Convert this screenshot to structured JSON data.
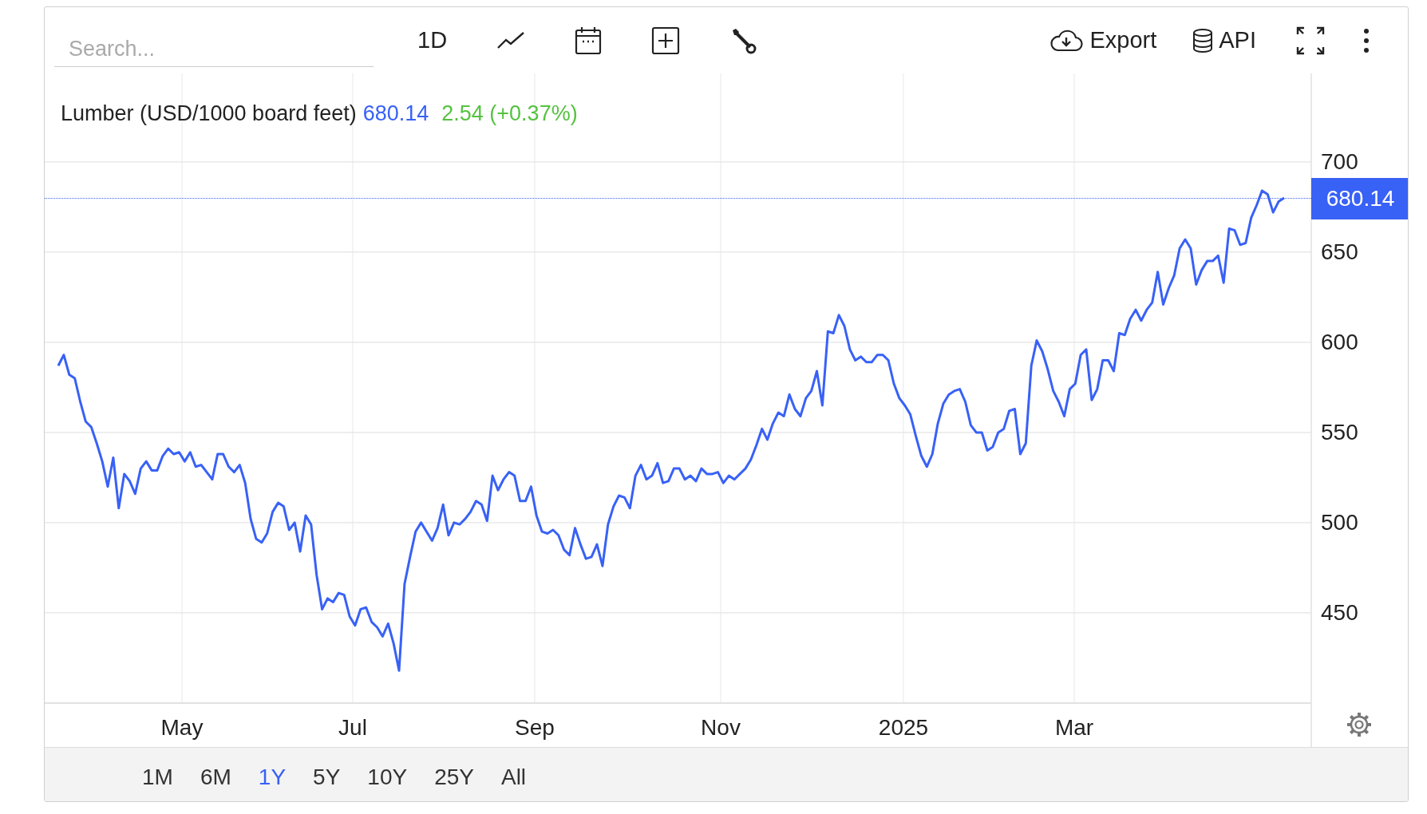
{
  "toolbar": {
    "search": {
      "placeholder": "Search..."
    },
    "interval": "1D",
    "export_label": "Export",
    "api_label": "API"
  },
  "chart": {
    "title": "Lumber (USD/1000 board feet)",
    "last_price": "680.14",
    "change": "2.54 (+0.37%)",
    "price_badge": "680.14",
    "x_labels": [
      "May",
      "Jul",
      "Sep",
      "Nov",
      "2025",
      "Mar"
    ],
    "chart_data": {
      "type": "line",
      "ylim": [
        400,
        749
      ],
      "grid": true,
      "yticks": [
        450,
        500,
        550,
        600,
        650,
        700
      ],
      "series": [
        {
          "color": "#3861f6",
          "values": [
            587,
            593,
            582,
            580,
            567,
            556,
            553,
            544,
            534,
            520,
            536,
            508,
            527,
            523,
            516,
            530,
            534,
            529,
            529,
            537,
            541,
            538,
            539,
            534,
            539,
            531,
            532,
            528,
            524,
            538,
            538,
            531,
            528,
            532,
            522,
            502,
            491,
            489,
            494,
            506,
            511,
            509,
            496,
            500,
            484,
            504,
            499,
            471,
            452,
            458,
            456,
            461,
            460,
            448,
            443,
            452,
            453,
            445,
            442,
            437,
            444,
            433,
            418,
            466,
            481,
            495,
            500,
            495,
            490,
            497,
            510,
            493,
            500,
            499,
            502,
            506,
            512,
            510,
            501,
            526,
            518,
            524,
            528,
            526,
            512,
            512,
            520,
            504,
            495,
            494,
            496,
            493,
            485,
            482,
            497,
            488,
            480,
            481,
            488,
            476,
            499,
            509,
            515,
            514,
            508,
            526,
            532,
            524,
            526,
            533,
            522,
            523,
            530,
            530,
            524,
            526,
            523,
            530,
            527,
            527,
            528,
            522,
            526,
            524,
            527,
            530,
            535,
            543,
            552,
            546,
            555,
            561,
            559,
            571,
            563,
            559,
            569,
            573,
            584,
            565,
            606,
            605,
            615,
            609,
            596,
            590,
            592,
            589,
            589,
            593,
            593,
            590,
            577,
            569,
            565,
            560,
            548,
            537,
            531,
            538,
            555,
            566,
            571,
            573,
            574,
            567,
            554,
            550,
            550,
            540,
            542,
            550,
            552,
            562,
            563,
            538,
            544,
            587,
            601,
            595,
            585,
            573,
            567,
            559,
            574,
            577,
            593,
            596,
            568,
            574,
            590,
            590,
            584,
            605,
            604,
            613,
            618,
            612,
            618,
            622,
            639,
            621,
            630,
            637,
            652,
            657,
            652,
            632,
            640,
            645,
            645,
            648,
            633,
            663,
            662,
            654,
            655,
            669,
            676,
            684,
            682,
            672,
            678,
            680
          ]
        }
      ]
    }
  },
  "ranges": [
    {
      "label": "1M",
      "selected": false
    },
    {
      "label": "6M",
      "selected": false
    },
    {
      "label": "1Y",
      "selected": true
    },
    {
      "label": "5Y",
      "selected": false
    },
    {
      "label": "10Y",
      "selected": false
    },
    {
      "label": "25Y",
      "selected": false
    },
    {
      "label": "All",
      "selected": false
    }
  ]
}
